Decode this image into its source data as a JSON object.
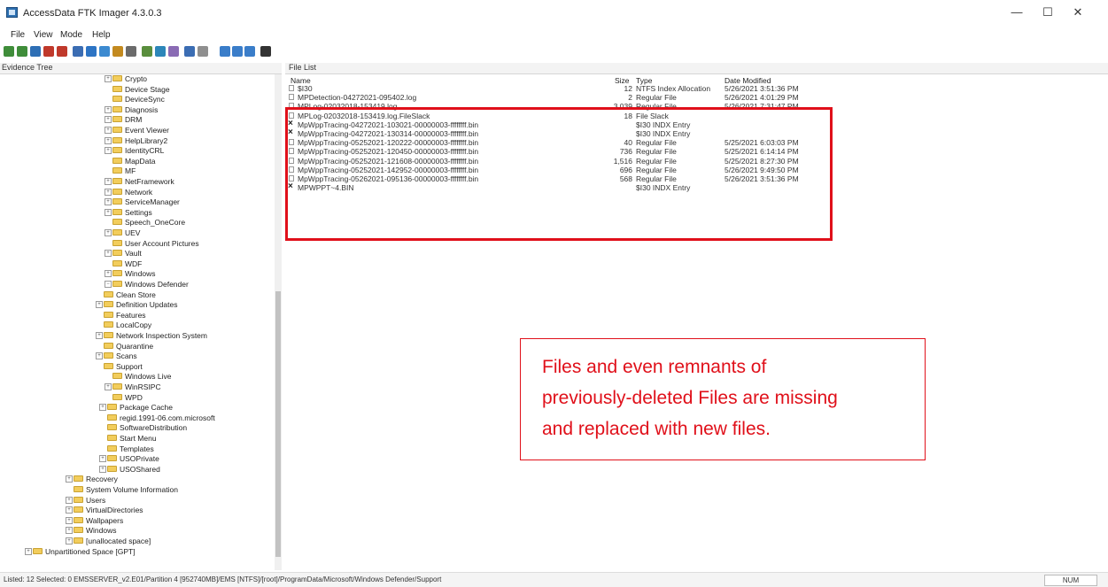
{
  "window": {
    "title": "AccessData FTK Imager 4.3.0.3",
    "minimize": "—",
    "maximize": "☐",
    "close": "✕"
  },
  "menu": [
    "File",
    "View",
    "Mode",
    "Help"
  ],
  "toolbar": {
    "icons": [
      "add-evidence-icon",
      "add-all-icon",
      "image-mounting-icon",
      "remove-evidence-icon",
      "remove-all-icon",
      "create-image-icon",
      "export-disk-image-icon",
      "export-logical-image-icon",
      "add-to-custom-icon",
      "export-files-icon",
      "export-hash-icon",
      "verify-icon",
      "capture-memory-icon",
      "obtain-protected-files-icon",
      "detect-encryption-icon",
      "auto-view-icon",
      "text-view-icon",
      "hex-view-icon",
      "help-icon"
    ]
  },
  "evidence_tree": {
    "header": "Evidence Tree",
    "items": [
      {
        "label": "Crypto",
        "depth": 3,
        "exp": "+"
      },
      {
        "label": "Device Stage",
        "depth": 3,
        "exp": ""
      },
      {
        "label": "DeviceSync",
        "depth": 3,
        "exp": ""
      },
      {
        "label": "Diagnosis",
        "depth": 3,
        "exp": "+"
      },
      {
        "label": "DRM",
        "depth": 3,
        "exp": "+"
      },
      {
        "label": "Event Viewer",
        "depth": 3,
        "exp": "+"
      },
      {
        "label": "HelpLibrary2",
        "depth": 3,
        "exp": "+"
      },
      {
        "label": "IdentityCRL",
        "depth": 3,
        "exp": "+"
      },
      {
        "label": "MapData",
        "depth": 3,
        "exp": ""
      },
      {
        "label": "MF",
        "depth": 3,
        "exp": ""
      },
      {
        "label": "NetFramework",
        "depth": 3,
        "exp": "+"
      },
      {
        "label": "Network",
        "depth": 3,
        "exp": "+"
      },
      {
        "label": "ServiceManager",
        "depth": 3,
        "exp": "+"
      },
      {
        "label": "Settings",
        "depth": 3,
        "exp": "+"
      },
      {
        "label": "Speech_OneCore",
        "depth": 3,
        "exp": ""
      },
      {
        "label": "UEV",
        "depth": 3,
        "exp": "+"
      },
      {
        "label": "User Account Pictures",
        "depth": 3,
        "exp": ""
      },
      {
        "label": "Vault",
        "depth": 3,
        "exp": "+"
      },
      {
        "label": "WDF",
        "depth": 3,
        "exp": ""
      },
      {
        "label": "Windows",
        "depth": 3,
        "exp": "+"
      },
      {
        "label": "Windows Defender",
        "depth": 3,
        "exp": "-"
      },
      {
        "label": "Clean Store",
        "depth": 4,
        "exp": ""
      },
      {
        "label": "Definition Updates",
        "depth": 4,
        "exp": "+"
      },
      {
        "label": "Features",
        "depth": 4,
        "exp": ""
      },
      {
        "label": "LocalCopy",
        "depth": 4,
        "exp": ""
      },
      {
        "label": "Network Inspection System",
        "depth": 4,
        "exp": "+"
      },
      {
        "label": "Quarantine",
        "depth": 4,
        "exp": ""
      },
      {
        "label": "Scans",
        "depth": 4,
        "exp": "+"
      },
      {
        "label": "Support",
        "depth": 4,
        "exp": ""
      },
      {
        "label": "Windows Live",
        "depth": 3,
        "exp": ""
      },
      {
        "label": "WinRSIPC",
        "depth": 3,
        "exp": "+"
      },
      {
        "label": "WPD",
        "depth": 3,
        "exp": ""
      },
      {
        "label": "Package Cache",
        "depth": 2,
        "exp": "+"
      },
      {
        "label": "regid.1991-06.com.microsoft",
        "depth": 2,
        "exp": ""
      },
      {
        "label": "SoftwareDistribution",
        "depth": 2,
        "exp": ""
      },
      {
        "label": "Start Menu",
        "depth": 2,
        "exp": ""
      },
      {
        "label": "Templates",
        "depth": 2,
        "exp": ""
      },
      {
        "label": "USOPrivate",
        "depth": 2,
        "exp": "+"
      },
      {
        "label": "USOShared",
        "depth": 2,
        "exp": "+"
      },
      {
        "label": "Recovery",
        "depth": 1,
        "exp": "+"
      },
      {
        "label": "System Volume Information",
        "depth": 1,
        "exp": ""
      },
      {
        "label": "Users",
        "depth": 1,
        "exp": "+"
      },
      {
        "label": "VirtualDirectories",
        "depth": 1,
        "exp": "+"
      },
      {
        "label": "Wallpapers",
        "depth": 1,
        "exp": "+"
      },
      {
        "label": "Windows",
        "depth": 1,
        "exp": "+"
      },
      {
        "label": "[unallocated space]",
        "depth": 1,
        "exp": "+"
      },
      {
        "label": "Unpartitioned Space [GPT]",
        "depth": 0,
        "exp": "+"
      }
    ]
  },
  "file_list": {
    "header": "File List",
    "columns": {
      "name": "Name",
      "size": "Size",
      "type": "Type",
      "date": "Date Modified"
    },
    "rows": [
      {
        "name": "$I30",
        "size": "12",
        "type": "NTFS Index Allocation",
        "date": "5/26/2021 3:51:36 PM",
        "deleted": false
      },
      {
        "name": "MPDetection-04272021-095402.log",
        "size": "2",
        "type": "Regular File",
        "date": "5/26/2021 4:01:29 PM",
        "deleted": false
      },
      {
        "name": "MPLog-02032018-153419.log",
        "size": "3,039",
        "type": "Regular File",
        "date": "5/26/2021 7:31:47 PM",
        "deleted": false
      },
      {
        "name": "MPLog-02032018-153419.log.FileSlack",
        "size": "18",
        "type": "File Slack",
        "date": "",
        "deleted": false
      },
      {
        "name": "MpWppTracing-04272021-103021-00000003-ffffffff.bin",
        "size": "",
        "type": "$I30 INDX Entry",
        "date": "",
        "deleted": true
      },
      {
        "name": "MpWppTracing-04272021-130314-00000003-ffffffff.bin",
        "size": "",
        "type": "$I30 INDX Entry",
        "date": "",
        "deleted": true
      },
      {
        "name": "MpWppTracing-05252021-120222-00000003-ffffffff.bin",
        "size": "40",
        "type": "Regular File",
        "date": "5/25/2021 6:03:03 PM",
        "deleted": false
      },
      {
        "name": "MpWppTracing-05252021-120450-00000003-ffffffff.bin",
        "size": "736",
        "type": "Regular File",
        "date": "5/25/2021 6:14:14 PM",
        "deleted": false
      },
      {
        "name": "MpWppTracing-05252021-121608-00000003-ffffffff.bin",
        "size": "1,516",
        "type": "Regular File",
        "date": "5/25/2021 8:27:30 PM",
        "deleted": false
      },
      {
        "name": "MpWppTracing-05252021-142952-00000003-ffffffff.bin",
        "size": "696",
        "type": "Regular File",
        "date": "5/26/2021 9:49:50 PM",
        "deleted": false
      },
      {
        "name": "MpWppTracing-05262021-095136-00000003-ffffffff.bin",
        "size": "568",
        "type": "Regular File",
        "date": "5/26/2021 3:51:36 PM",
        "deleted": false
      },
      {
        "name": "MPWPPT~4.BIN",
        "size": "",
        "type": "$I30 INDX Entry",
        "date": "",
        "deleted": true
      }
    ]
  },
  "annotation": {
    "line1": "Files and even remnants of",
    "line2": "previously-deleted Files are missing",
    "line3": "and replaced with new files.",
    "color": "#e0101a"
  },
  "status": {
    "text": "Listed: 12  Selected: 0  EMSSERVER_v2.E01/Partition 4 [952740MB]/EMS [NTFS]/[root]/ProgramData/Microsoft/Windows Defender/Support",
    "num": "NUM"
  }
}
